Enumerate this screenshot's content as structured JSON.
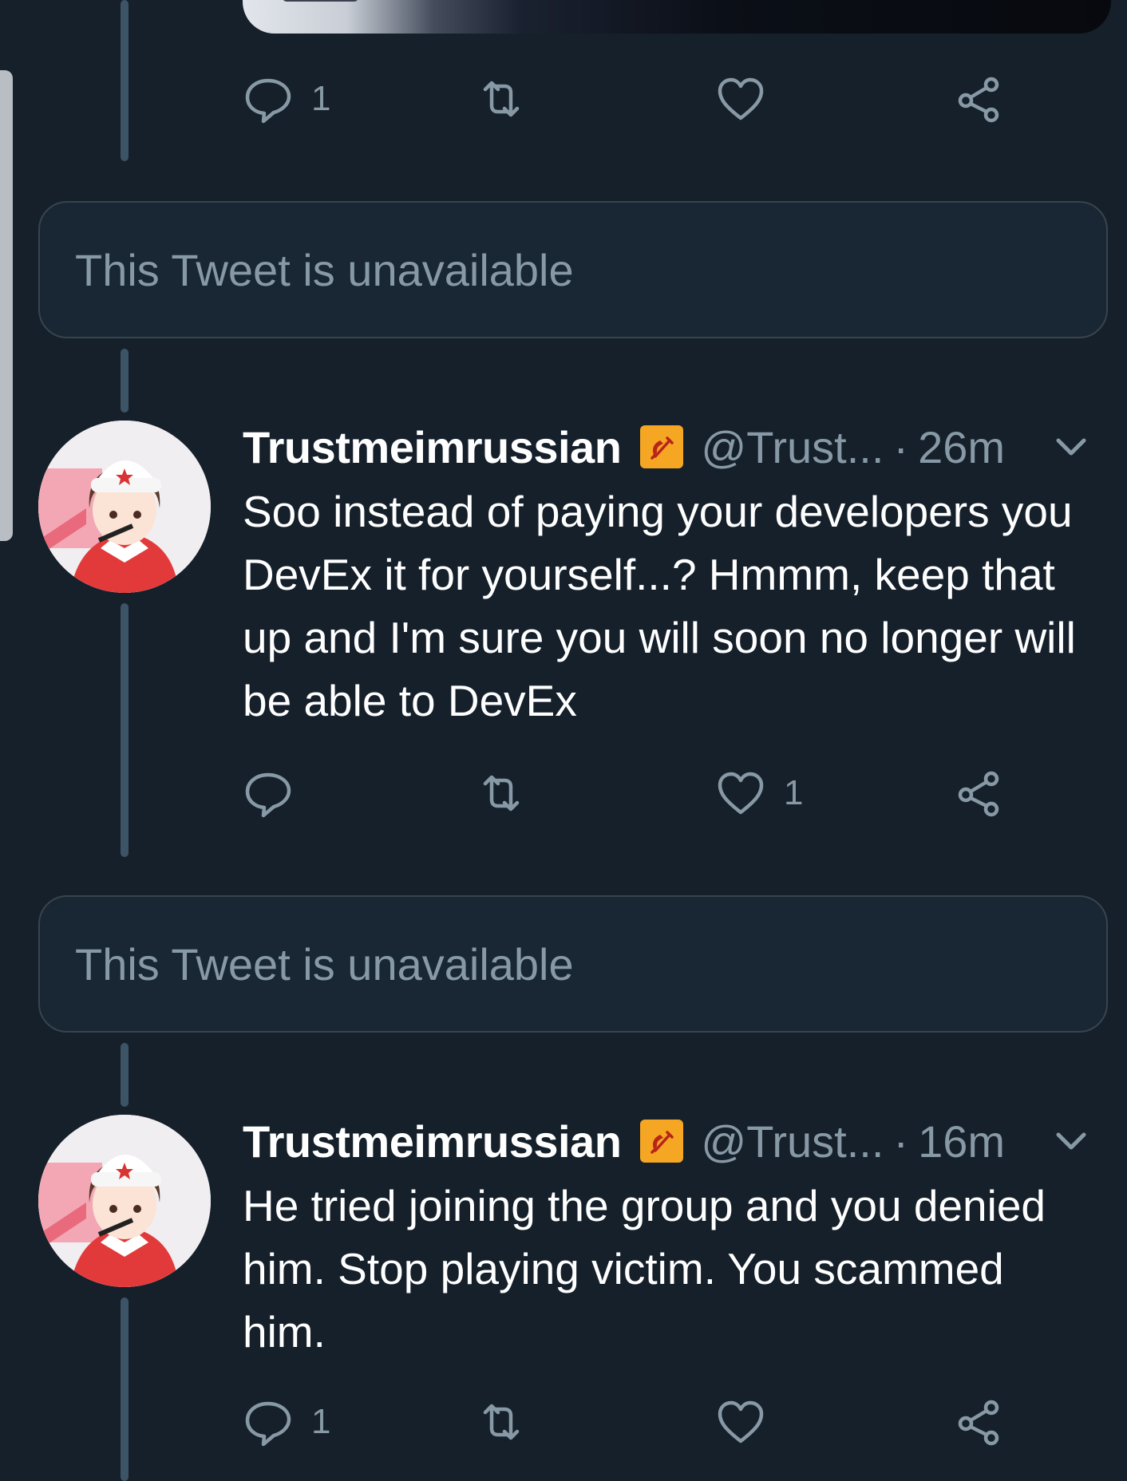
{
  "colors": {
    "background": "#15202b",
    "card": "#192734",
    "border": "#38444d",
    "muted": "#8899a6",
    "text": "#ffffff",
    "flag": "#f5a623"
  },
  "top_tweet": {
    "reply_count": "1",
    "retweet_count": "",
    "like_count": ""
  },
  "unavailable_1": {
    "text": "This Tweet is unavailable"
  },
  "tweet_1": {
    "name": "Trustmeimrussian",
    "flag_icon": "hammer-sickle-icon",
    "handle": "@Trust...",
    "separator": "·",
    "time": "26m",
    "text": "Soo instead of paying your developers you DevEx it for yourself...? Hmmm, keep that up and I'm sure you will soon no longer will be able to DevEx",
    "reply_count": "",
    "retweet_count": "",
    "like_count": "1"
  },
  "unavailable_2": {
    "text": "This Tweet is unavailable"
  },
  "tweet_2": {
    "name": "Trustmeimrussian",
    "flag_icon": "hammer-sickle-icon",
    "handle": "@Trust...",
    "separator": "·",
    "time": "16m",
    "text": "He tried joining the group and you denied him. Stop playing victim. You scammed him.",
    "reply_count": "1",
    "retweet_count": "",
    "like_count": ""
  }
}
